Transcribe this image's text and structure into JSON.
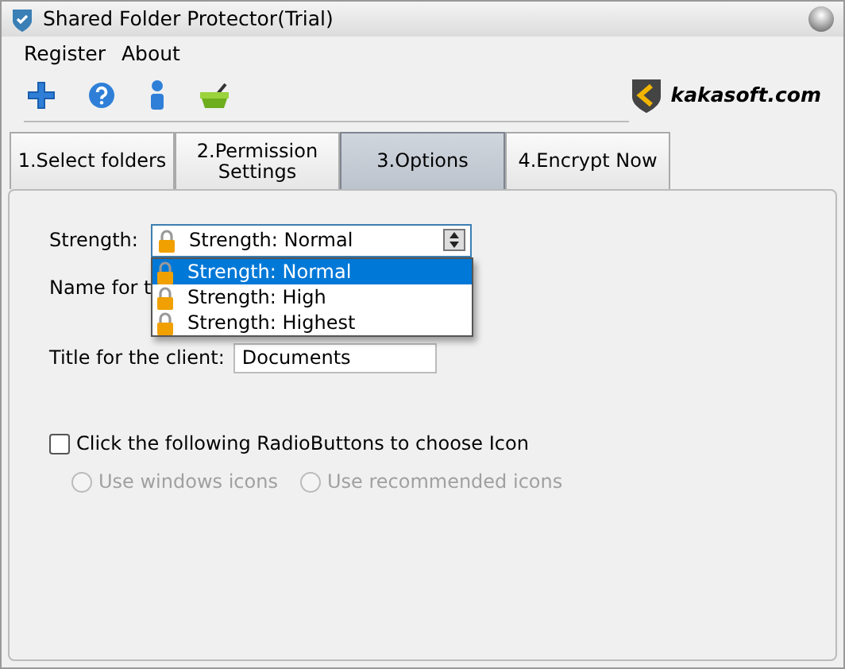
{
  "window": {
    "title": "Shared Folder Protector(Trial)"
  },
  "menu": [
    "Register",
    "About"
  ],
  "logo": {
    "text": "kakasoft.com"
  },
  "tabs": [
    {
      "label": "1.Select folders",
      "selected": false
    },
    {
      "label": "2.Permission Settings",
      "selected": false
    },
    {
      "label": "3.Options",
      "selected": true
    },
    {
      "label": "4.Encrypt Now",
      "selected": false
    }
  ],
  "options": {
    "strength": {
      "label": "Strength:",
      "value": "Strength: Normal",
      "expanded": true,
      "items": [
        {
          "label": "Strength: Normal",
          "selected": true
        },
        {
          "label": "Strength: High",
          "selected": false
        },
        {
          "label": "Strength: Highest",
          "selected": false
        }
      ]
    },
    "name_label": "Name for t",
    "title_label": "Title for the client:",
    "title_value": "Documents",
    "icon_choice": {
      "label": "Click the following RadioButtons to choose Icon",
      "checked": false
    },
    "radios": [
      {
        "label": "Use windows icons",
        "selected": false,
        "disabled": true
      },
      {
        "label": "Use recommended icons",
        "selected": false,
        "disabled": true
      }
    ]
  }
}
